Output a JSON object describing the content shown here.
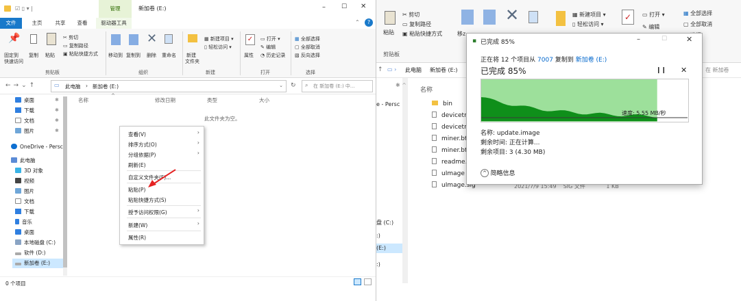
{
  "left": {
    "title_context": "管理",
    "title": "新加卷 (E:)",
    "tabs": [
      "文件",
      "主页",
      "共享",
      "查看",
      "驱动器工具"
    ],
    "ribbon": {
      "pin": "固定到",
      "pin2": "快速访问",
      "copy": "复制",
      "paste": "粘贴",
      "cut": "剪切",
      "copy_path": "复制路径",
      "paste_shortcut": "粘贴快捷方式",
      "move_to": "移动到",
      "copy_to": "复制到",
      "delete": "删除",
      "rename": "重命名",
      "new_folder": "新建",
      "new_folder2": "文件夹",
      "new_item": "新建项目",
      "easy_access": "轻松访问",
      "properties": "属性",
      "open": "打开",
      "edit": "编辑",
      "history": "历史记录",
      "select_all": "全部选择",
      "select_none": "全部取消",
      "invert": "反向选择",
      "groups": [
        "剪贴板",
        "组织",
        "新建",
        "打开",
        "选择"
      ]
    },
    "address": {
      "root": "此电脑",
      "sep": "›",
      "current": "新加卷 (E:)",
      "search_placeholder": "在 新加卷 (E:) 中..."
    },
    "sidebar": [
      "桌面",
      "下载",
      "文档",
      "图片",
      "OneDrive - Persc",
      "此电脑",
      "3D 对象",
      "视频",
      "图片",
      "文档",
      "下载",
      "音乐",
      "桌面",
      "本地磁盘 (C:)",
      "软件 (D:)",
      "新加卷 (E:)"
    ],
    "columns": {
      "name": "名称",
      "date": "修改日期",
      "type": "类型",
      "size": "大小"
    },
    "empty_text": "此文件夹为空。",
    "status": "0 个项目",
    "menu": [
      "查看(V)",
      "排序方式(O)",
      "分组依据(P)",
      "刷新(E)",
      "自定义文件夹(F)...",
      "粘贴(P)",
      "粘贴快捷方式(S)",
      "授予访问权限(G)",
      "新建(W)",
      "属性(R)"
    ]
  },
  "right": {
    "ribbon": {
      "paste": "粘贴",
      "cut": "剪切",
      "copy_path": "复制路径",
      "paste_shortcut": "粘贴快捷方式",
      "move": "移z",
      "new_item": "新建项目",
      "easy_access": "轻松访问",
      "open": "打开",
      "edit": "编辑",
      "select_all": "全部选择",
      "select_none": "全部取消",
      "invert": "选择",
      "clip_group": "剪贴板",
      "sel_group": "择"
    },
    "address": {
      "root": "此电脑",
      "current": "新加卷 (E:)",
      "search_placeholder": "在 新加卷"
    },
    "column_name": "名称",
    "files": [
      "bin",
      "devicetree",
      "devicetree",
      "miner.btm",
      "miner.btm.",
      "readme.fac",
      "uImage",
      "uImage.sig"
    ],
    "left_fragments": [
      "e - Persc",
      "盘 (C:)",
      ":)",
      "(E:)",
      ":)"
    ],
    "partial_row": "2021/7/9 15:49    SIG 文件            1 KB"
  },
  "dialog": {
    "title": "已完成 85%",
    "line_prefix": "正在将 12 个项目从 ",
    "src": "7007",
    "mid": " 复制到 ",
    "dst": "新加卷 (E:)",
    "heading": "已完成 85%",
    "progress": 0.85,
    "speed": "速度: 5.55 MB/秒",
    "name": "名称: update.image",
    "time_left": "剩余时间: 正在计算...",
    "items_left": "剩余项目: 3 (4.30 MB)",
    "less_info": "简略信息",
    "colors": {
      "fill": "#9de09b",
      "graph": "#0f8f1a",
      "line": "#3b3b3b"
    }
  }
}
